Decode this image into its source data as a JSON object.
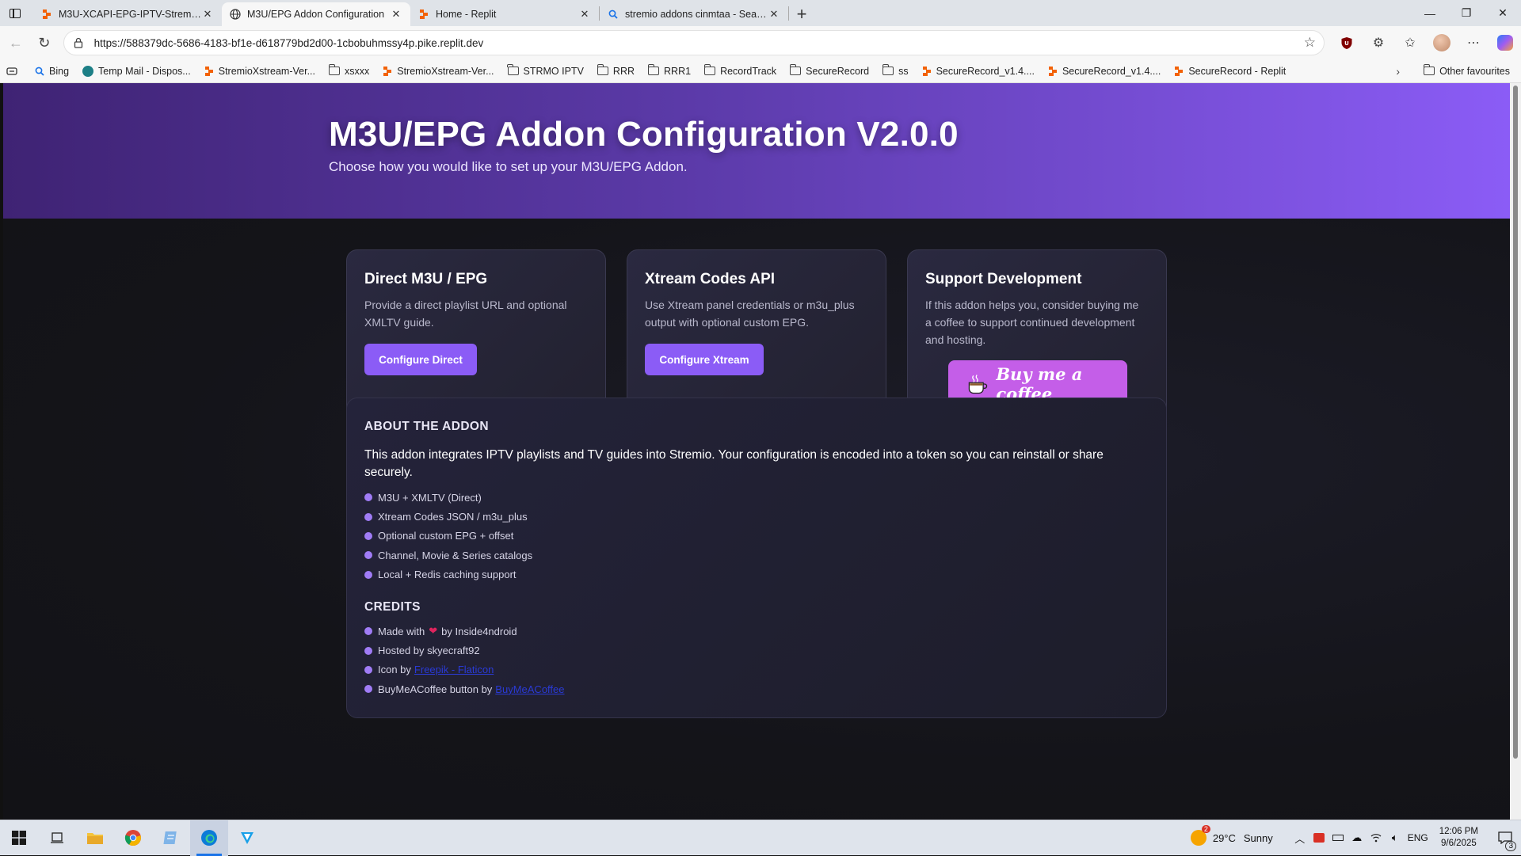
{
  "browser": {
    "tabs": [
      {
        "title": "M3U-XCAPI-EPG-IPTV-Stremio - R",
        "icon": "replit-icon",
        "active": false
      },
      {
        "title": "M3U/EPG Addon Configuration",
        "icon": "globe-icon",
        "active": true
      },
      {
        "title": "Home - Replit",
        "icon": "replit-icon",
        "active": false
      },
      {
        "title": "stremio addons cinmtaa - Search",
        "icon": "search-icon",
        "active": false
      }
    ],
    "url": "https://588379dc-5686-4183-bf1e-d618779bd2d00-1cbobuhmssy4p.pike.replit.dev",
    "bookmarks": [
      {
        "label": "Bing",
        "icon": "search-icon"
      },
      {
        "label": "Temp Mail - Dispos...",
        "icon": "tempmail-icon"
      },
      {
        "label": "StremioXstream-Ver...",
        "icon": "replit-icon"
      },
      {
        "label": "xsxxx",
        "icon": "folder-icon"
      },
      {
        "label": "StremioXstream-Ver...",
        "icon": "replit-icon"
      },
      {
        "label": "STRMO IPTV",
        "icon": "folder-icon"
      },
      {
        "label": "RRR",
        "icon": "folder-icon"
      },
      {
        "label": "RRR1",
        "icon": "folder-icon"
      },
      {
        "label": "RecordTrack",
        "icon": "folder-icon"
      },
      {
        "label": "SecureRecord",
        "icon": "folder-icon"
      },
      {
        "label": "ss",
        "icon": "folder-icon"
      },
      {
        "label": "SecureRecord_v1.4....",
        "icon": "replit-icon"
      },
      {
        "label": "SecureRecord_v1.4....",
        "icon": "replit-icon"
      },
      {
        "label": "SecureRecord - Replit",
        "icon": "replit-icon"
      }
    ],
    "other_favourites": "Other favourites"
  },
  "hero": {
    "title": "M3U/EPG Addon Configuration V2.0.0",
    "subtitle": "Choose how you would like to set up your M3U/EPG Addon."
  },
  "cards": {
    "direct": {
      "title": "Direct M3U / EPG",
      "description": "Provide a direct playlist URL and optional XMLTV guide.",
      "button": "Configure Direct"
    },
    "xtream": {
      "title": "Xtream Codes API",
      "description": "Use Xtream panel credentials or m3u_plus output with optional custom EPG.",
      "button": "Configure Xtream"
    },
    "support": {
      "title": "Support Development",
      "description": "If this addon helps you, consider buying me a coffee to support continued development and hosting.",
      "button": "Buy me a coffee"
    }
  },
  "about": {
    "heading": "ABOUT THE ADDON",
    "lead": "This addon integrates IPTV playlists and TV guides into Stremio. Your configuration is encoded into a token so you can reinstall or share securely.",
    "features": [
      "M3U + XMLTV (Direct)",
      "Xtream Codes JSON / m3u_plus",
      "Optional custom EPG + offset",
      "Channel, Movie & Series catalogs",
      "Local + Redis caching support"
    ],
    "credits_heading": "CREDITS",
    "credits": {
      "made_prefix": "Made with",
      "made_suffix": "by Inside4ndroid",
      "hosted": "Hosted by skyecraft92",
      "icon_prefix": "Icon by",
      "icon_link": "Freepik - Flaticon",
      "bmc_prefix": "BuyMeACoffee button by",
      "bmc_link": "BuyMeACoffee"
    }
  },
  "taskbar": {
    "weather_temp": "29°C",
    "weather_text": "Sunny",
    "weather_badge": "2",
    "lang": "ENG",
    "time": "12:06 PM",
    "date": "9/6/2025",
    "notif_count": "3"
  },
  "colors": {
    "accent": "#8b5cf6",
    "coffee_button": "#c45ee8",
    "hero_start": "#3f2374",
    "hero_end": "#8b5cf6"
  }
}
